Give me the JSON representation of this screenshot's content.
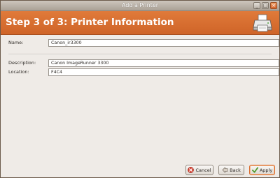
{
  "window": {
    "title": "Add a Printer",
    "minimize_glyph": "_",
    "maximize_glyph": "□",
    "close_glyph": "×"
  },
  "header": {
    "title": "Step 3 of 3: Printer Information",
    "icon": "printer-icon",
    "color": "#d96a2b"
  },
  "form": {
    "name_label": "Name:",
    "name_value": "Canon_ir3300",
    "description_label": "Description:",
    "description_value": "Canon ImageRunner 3300",
    "location_label": "Location:",
    "location_value": "F4C4"
  },
  "buttons": {
    "cancel_label": "Cancel",
    "back_label": "Back",
    "apply_label": "Apply"
  }
}
